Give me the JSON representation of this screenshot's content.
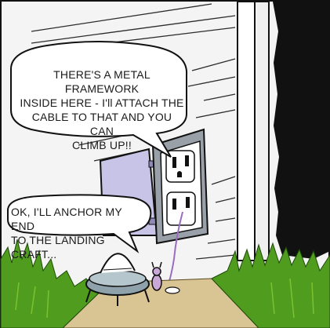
{
  "comic": {
    "balloon_top": {
      "text": "THERE'S A METAL FRAMEWORK\nINSIDE HERE - I'll ATTACH THE\nCABLE TO THAT AND YOU CAN\nCLIMB UP!!"
    },
    "balloon_bottom": {
      "text": "OK, I'LL ANCHOR MY END\nTO THE LANDING CRAFT..."
    },
    "colors": {
      "wall": "#f4f4f4",
      "siding_lines": "#2c2c2c",
      "outlet_plate": "#9aa0a8",
      "outlet_face": "#ffffff",
      "door_panel": "#c8c4e8",
      "grass": "#4f9c1e",
      "grass_light": "#7cc230",
      "dirt_path": "#d9c593",
      "shadow_side": "#111111",
      "craft_body": "#8fa2ab",
      "creature": "#c9a8d8"
    }
  }
}
